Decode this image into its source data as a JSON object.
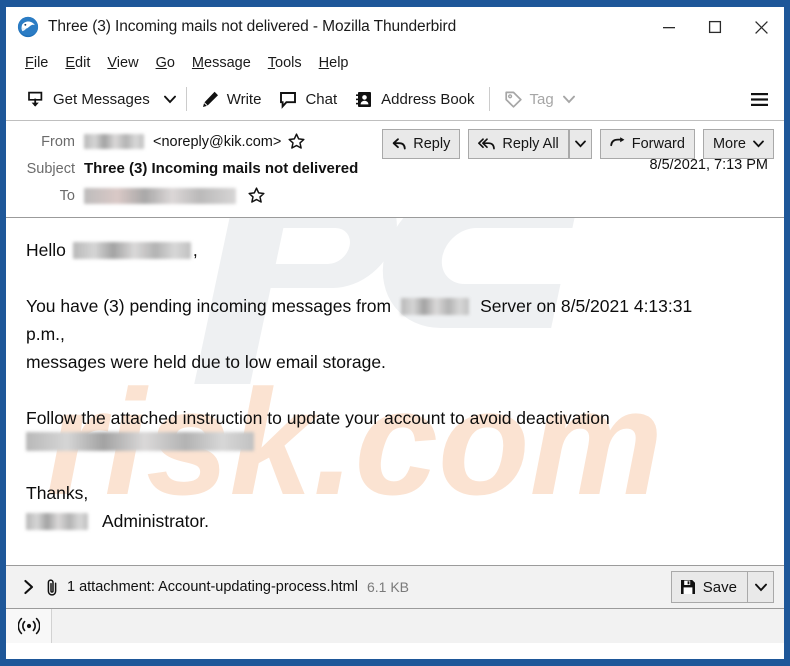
{
  "window": {
    "title": "Three (3) Incoming mails not delivered - Mozilla Thunderbird",
    "app_icon": "thunderbird-icon",
    "controls": {
      "minimize": "minimize-icon",
      "maximize": "maximize-icon",
      "close": "close-icon"
    },
    "border_color": "#1e5799"
  },
  "menubar": {
    "items": [
      {
        "label": "File",
        "accel": "F"
      },
      {
        "label": "Edit",
        "accel": "E"
      },
      {
        "label": "View",
        "accel": "V"
      },
      {
        "label": "Go",
        "accel": "G"
      },
      {
        "label": "Message",
        "accel": "M"
      },
      {
        "label": "Tools",
        "accel": "T"
      },
      {
        "label": "Help",
        "accel": "H"
      }
    ]
  },
  "toolbar": {
    "get_messages": "Get Messages",
    "write": "Write",
    "chat": "Chat",
    "address_book": "Address Book",
    "tag": "Tag",
    "tag_disabled": true,
    "hamburger": "hamburger-menu-icon"
  },
  "message_header": {
    "from_label": "From",
    "from_name_redacted": true,
    "from_address": "<noreply@kik.com>",
    "subject_label": "Subject",
    "subject": "Three (3) Incoming mails not delivered",
    "date": "8/5/2021, 7:13 PM",
    "to_label": "To",
    "to_redacted": true,
    "actions": {
      "reply": "Reply",
      "reply_all": "Reply All",
      "forward": "Forward",
      "more": "More"
    }
  },
  "body": {
    "greeting_prefix": "Hello",
    "greeting_suffix": ",",
    "line1_part1": "You have (3) pending incoming messages from",
    "line1_part2": "Server on 8/5/2021 4:13:31",
    "line2": "p.m.,",
    "line3": "messages were held due to low email storage.",
    "line4": "Follow the attached instruction to update your account to avoid deactivation",
    "line5_redacted": true,
    "signoff": "Thanks,",
    "signature_suffix": "Administrator."
  },
  "watermark": {
    "text_grey": "PC",
    "text_orange": "risk.com",
    "color_grey": "#eceef0",
    "color_orange": "#fbe6d8"
  },
  "attachment": {
    "expand_icon": "chevron-right-icon",
    "clip_icon": "paperclip-icon",
    "summary": "1 attachment: Account-updating-process.html",
    "size": "6.1 KB",
    "save_label": "Save",
    "save_icon": "save-disk-icon",
    "save_caret": "chevron-down-icon"
  },
  "statusbar": {
    "connection_icon": "broadcast-icon"
  }
}
